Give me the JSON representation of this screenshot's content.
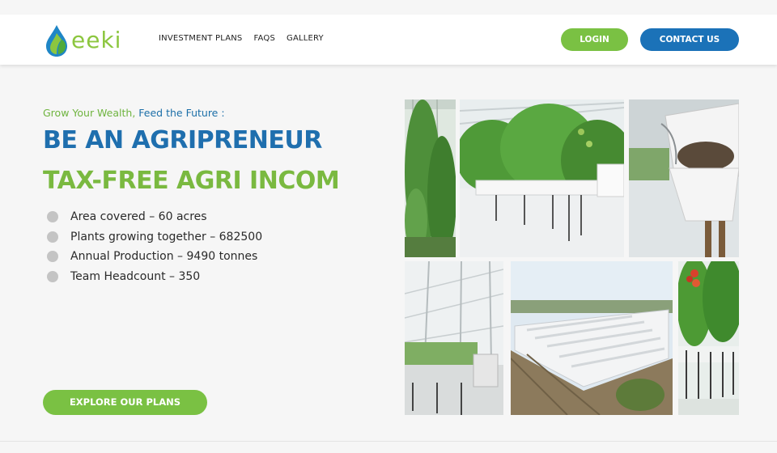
{
  "brand": {
    "name": "eeki",
    "color": "#8cc63f"
  },
  "nav": {
    "links": [
      "INVESTMENT PLANS",
      "FAQS",
      "GALLERY"
    ],
    "login_label": "LOGIN",
    "contact_label": "CONTACT US"
  },
  "hero": {
    "tagline_part1": "Grow Your Wealth, ",
    "tagline_part2": "Feed the Future :",
    "headline1": "BE AN AGRIPRENEUR",
    "headline2": "TAX-FREE AGRI INCOM",
    "bullets": [
      "Area covered – 60 acres",
      "Plants growing together – 682500",
      "Annual Production – 9490 tonnes",
      "Team Headcount – 350"
    ],
    "cta_label": "EXPLORE OUR PLANS"
  },
  "gallery": {
    "photos": [
      "tomato-vine-photo",
      "greenhouse-rows-photo",
      "hydroponic-pot-photo",
      "greenhouse-interior-photo",
      "greenhouse-aerial-photo",
      "tomato-plants-photo"
    ]
  },
  "colors": {
    "green": "#7ac143",
    "blue": "#1b72b8"
  }
}
